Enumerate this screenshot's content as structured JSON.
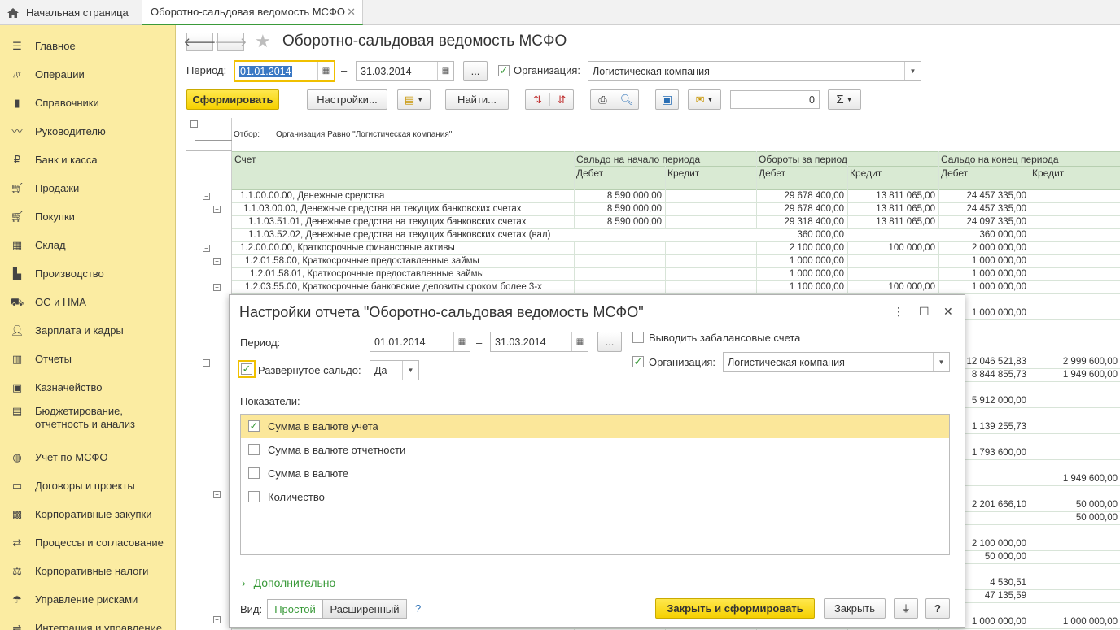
{
  "tabs": {
    "home": "Начальная страница",
    "active": "Оборотно-сальдовая ведомость МСФО"
  },
  "sidebar": {
    "items": [
      {
        "label": "Главное",
        "icon": "menu-icon"
      },
      {
        "label": "Операции",
        "icon": "debit-credit-icon"
      },
      {
        "label": "Справочники",
        "icon": "books-icon"
      },
      {
        "label": "Руководителю",
        "icon": "chart-line-icon"
      },
      {
        "label": "Банк и касса",
        "icon": "coin-icon"
      },
      {
        "label": "Продажи",
        "icon": "cart-icon"
      },
      {
        "label": "Покупки",
        "icon": "shopping-cart-icon"
      },
      {
        "label": "Склад",
        "icon": "warehouse-icon"
      },
      {
        "label": "Производство",
        "icon": "factory-icon"
      },
      {
        "label": "ОС и НМА",
        "icon": "truck-icon"
      },
      {
        "label": "Зарплата и кадры",
        "icon": "person-icon"
      },
      {
        "label": "Отчеты",
        "icon": "bar-chart-icon"
      },
      {
        "label": "Казначейство",
        "icon": "money-icon"
      },
      {
        "label": "Бюджетирование, отчетность и анализ",
        "icon": "budget-icon"
      },
      {
        "label": "Учет по МСФО",
        "icon": "globe-icon"
      },
      {
        "label": "Договоры и проекты",
        "icon": "contract-icon"
      },
      {
        "label": "Корпоративные закупки",
        "icon": "gift-icon"
      },
      {
        "label": "Процессы и согласование",
        "icon": "process-icon"
      },
      {
        "label": "Корпоративные налоги",
        "icon": "tax-icon"
      },
      {
        "label": "Управление рисками",
        "icon": "risk-icon"
      },
      {
        "label": "Интеграция и управление",
        "icon": "integration-icon"
      }
    ]
  },
  "header": {
    "title": "Оборотно-сальдовая ведомость МСФО",
    "period_label": "Период:",
    "date_from": "01.01.2014",
    "date_dash": "–",
    "date_to": "31.03.2014",
    "more_btn": "...",
    "org_label": "Организация:",
    "org_value": "Логистическая компания",
    "generate_btn": "Сформировать",
    "settings_btn": "Настройки...",
    "find_btn": "Найти...",
    "sum_value": "0"
  },
  "report": {
    "filter_label": "Отбор:",
    "filter_text": "Организация Равно \"Логистическая компания\"",
    "col_account": "Счет",
    "col_open": "Сальдо на начало периода",
    "col_turnover": "Обороты за период",
    "col_close": "Сальдо на конец периода",
    "debit": "Дебет",
    "credit": "Кредит",
    "rows": [
      {
        "acc": "1.1.00.00.00, Денежные средства",
        "od": "8 590 000,00",
        "oc": "",
        "td": "29 678 400,00",
        "tc": "13 811 065,00",
        "cd": "24 457 335,00",
        "cc": ""
      },
      {
        "acc": "1.1.03.00.00, Денежные средства на текущих банковских счетах",
        "od": "8 590 000,00",
        "oc": "",
        "td": "29 678 400,00",
        "tc": "13 811 065,00",
        "cd": "24 457 335,00",
        "cc": ""
      },
      {
        "acc": "1.1.03.51.01, Денежные средства на текущих банковских счетах",
        "od": "8 590 000,00",
        "oc": "",
        "td": "29 318 400,00",
        "tc": "13 811 065,00",
        "cd": "24 097 335,00",
        "cc": ""
      },
      {
        "acc": "1.1.03.52.02, Денежные средства на текущих банковских счетах (вал)",
        "od": "",
        "oc": "",
        "td": "360 000,00",
        "tc": "",
        "cd": "360 000,00",
        "cc": ""
      },
      {
        "acc": "1.2.00.00.00, Краткосрочные финансовые активы",
        "od": "",
        "oc": "",
        "td": "2 100 000,00",
        "tc": "100 000,00",
        "cd": "2 000 000,00",
        "cc": ""
      },
      {
        "acc": "1.2.01.58.00, Краткосрочные предоставленные займы",
        "od": "",
        "oc": "",
        "td": "1 000 000,00",
        "tc": "",
        "cd": "1 000 000,00",
        "cc": ""
      },
      {
        "acc": "1.2.01.58.01, Краткосрочные предоставленные займы",
        "od": "",
        "oc": "",
        "td": "1 000 000,00",
        "tc": "",
        "cd": "1 000 000,00",
        "cc": ""
      },
      {
        "acc": "1.2.03.55.00, Краткосрочные банковские депозиты сроком более 3-х",
        "od": "",
        "oc": "",
        "td": "1 100 000,00",
        "tc": "100 000,00",
        "cd": "1 000 000,00",
        "cc": ""
      }
    ],
    "hidden_rows": [
      {
        "cd": "1 000 000,00",
        "cc": ""
      },
      {
        "cd": "12 046 521,83",
        "cc": "2 999 600,00"
      },
      {
        "cd": "8 844 855,73",
        "cc": "1 949 600,00"
      },
      {
        "cd": "5 912 000,00",
        "cc": ""
      },
      {
        "cd": "1 139 255,73",
        "cc": ""
      },
      {
        "cd": "1 793 600,00",
        "cc": ""
      },
      {
        "cd": "",
        "cc": "1 949 600,00"
      },
      {
        "cd": "2 201 666,10",
        "cc": "50 000,00"
      },
      {
        "cd": "",
        "cc": "50 000,00"
      },
      {
        "cd": "2 100 000,00",
        "cc": ""
      },
      {
        "cd": "50 000,00",
        "cc": ""
      },
      {
        "cd": "4 530,51",
        "cc": ""
      },
      {
        "cd": "47 135,59",
        "cc": ""
      },
      {
        "cd": "1 000 000,00",
        "cc": "1 000 000,00"
      }
    ]
  },
  "dialog": {
    "title": "Настройки отчета \"Оборотно-сальдовая ведомость МСФО\"",
    "period_label": "Период:",
    "date_from": "01.01.2014",
    "date_dash": "–",
    "date_to": "31.03.2014",
    "more_btn": "...",
    "offbalance_label": "Выводить забалансовые счета",
    "org_label": "Организация:",
    "org_value": "Логистическая компания",
    "expanded_label": "Развернутое сальдо:",
    "expanded_value": "Да",
    "indicators_label": "Показатели:",
    "indicators": [
      {
        "label": "Сумма в валюте учета",
        "checked": true
      },
      {
        "label": "Сумма в валюте отчетности",
        "checked": false
      },
      {
        "label": "Сумма в валюте",
        "checked": false
      },
      {
        "label": "Количество",
        "checked": false
      }
    ],
    "additional_label": "Дополнительно",
    "view_label": "Вид:",
    "view_simple": "Простой",
    "view_extended": "Расширенный",
    "help_q": "?",
    "close_generate_btn": "Закрыть и сформировать",
    "close_btn": "Закрыть",
    "help_btn": "?"
  }
}
